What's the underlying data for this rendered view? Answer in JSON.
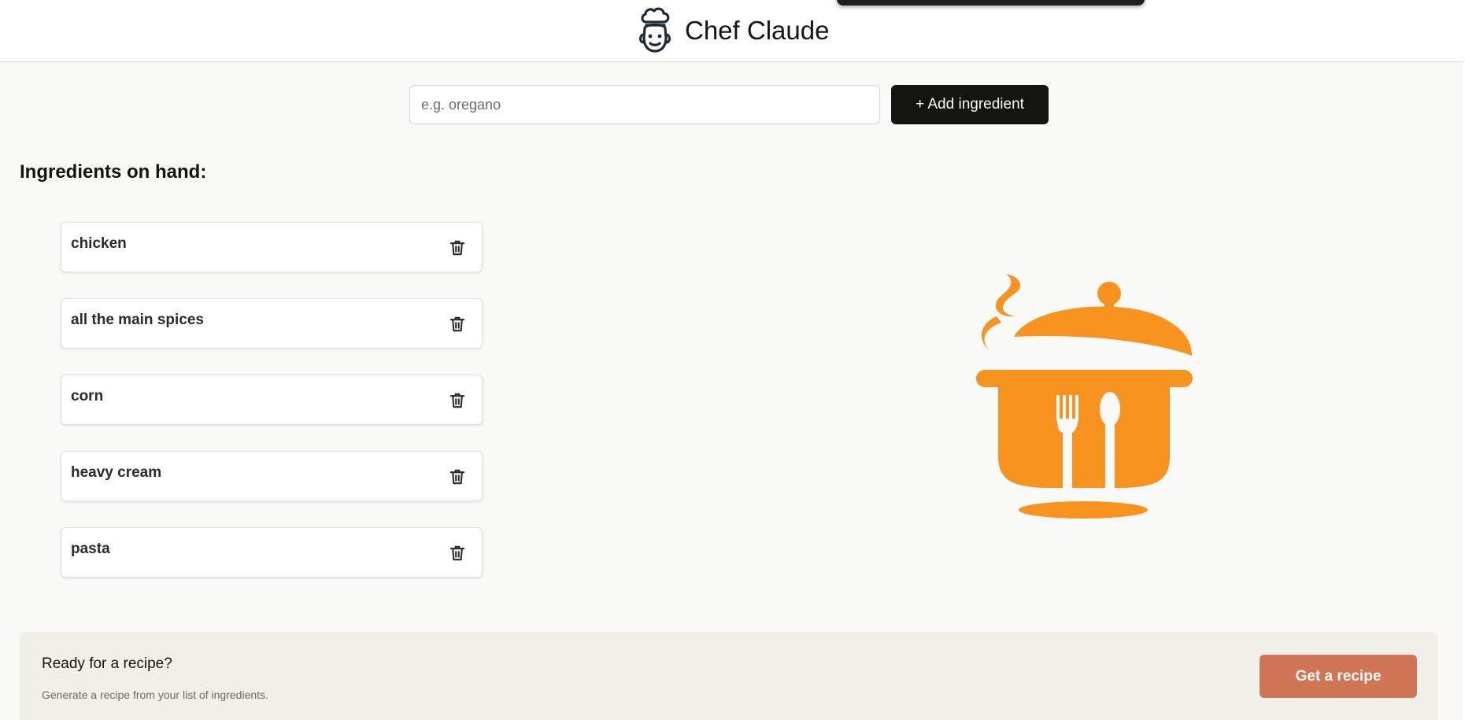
{
  "header": {
    "title": "Chef Claude",
    "logo_icon": "chef-head-icon"
  },
  "form": {
    "placeholder": "e.g. oregano",
    "value": "",
    "add_label": "+ Add ingredient"
  },
  "ingredients": {
    "heading": "Ingredients on hand:",
    "items": [
      {
        "label": "chicken"
      },
      {
        "label": "all the main spices"
      },
      {
        "label": "corn"
      },
      {
        "label": "heavy cream"
      },
      {
        "label": "pasta"
      }
    ],
    "delete_icon": "trash-icon"
  },
  "illustration": {
    "icon": "cooking-pot-icon",
    "color": "#f7931e"
  },
  "cta": {
    "title": "Ready for a recipe?",
    "subtitle": "Generate a recipe from your list of ingredients.",
    "button_label": "Get a recipe",
    "button_color": "#d17557"
  }
}
